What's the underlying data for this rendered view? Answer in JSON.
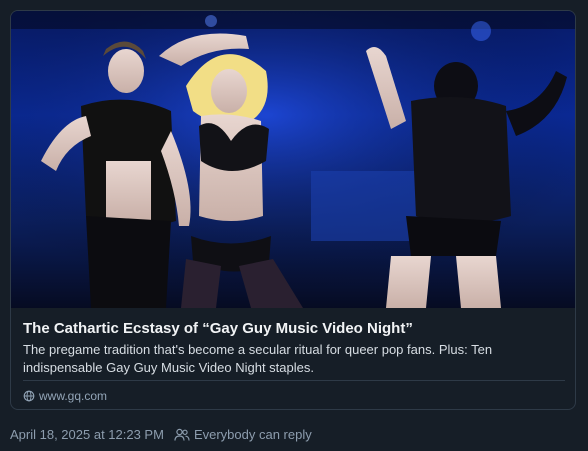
{
  "link_card": {
    "image_alt": "Performers on stage in black outfits under blue lights",
    "title": "The Cathartic Ecstasy of “Gay Guy Music Video Night”",
    "description": "The pregame tradition that's become a secular ritual for queer pop fans. Plus: Ten indispensable Gay Guy Music Video Night staples.",
    "domain": "www.gq.com",
    "domain_icon": "globe-icon"
  },
  "post_meta": {
    "timestamp": "April 18, 2025 at 12:23 PM",
    "reply_setting_icon": "people-icon",
    "reply_setting": "Everybody can reply"
  },
  "colors": {
    "background": "#161e27",
    "border": "#2e3a47",
    "title_text": "#f1f3f5",
    "muted_text": "#8d9dae",
    "stage_blue": "#0a2a9a"
  }
}
